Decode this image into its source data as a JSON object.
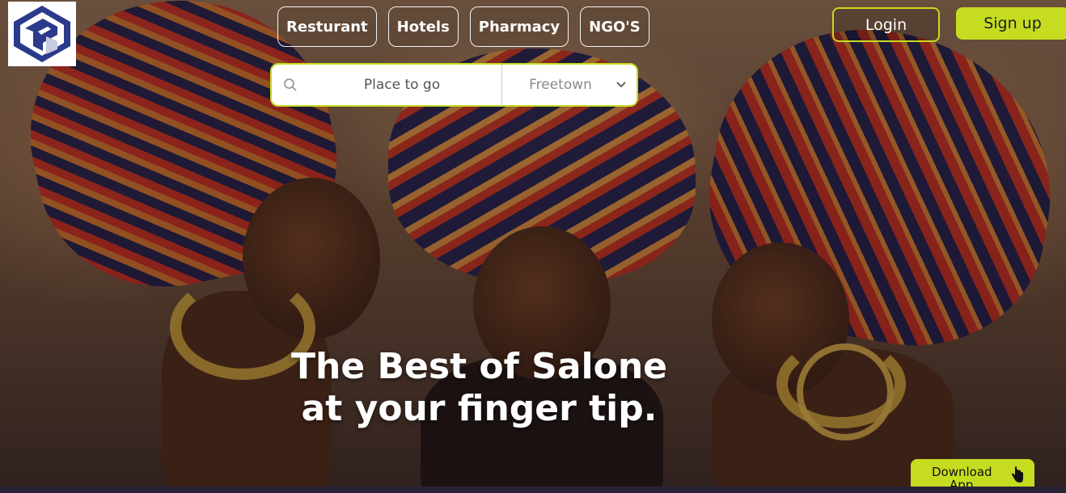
{
  "brand": {
    "logo_icon": "swirl-logo-icon"
  },
  "nav": {
    "items": [
      {
        "label": "Resturant"
      },
      {
        "label": "Hotels"
      },
      {
        "label": "Pharmacy"
      },
      {
        "label": "NGO'S"
      }
    ]
  },
  "auth": {
    "login_label": "Login",
    "signup_label": "Sign up"
  },
  "search": {
    "placeholder": "Place to go",
    "icon": "search-icon",
    "city_selected": "Freetown",
    "city_icon": "chevron-down-icon"
  },
  "hero": {
    "headline_line1": "The Best of Salone",
    "headline_line2": "at your finger tip."
  },
  "download": {
    "label_line1": "Download",
    "label_line2": "App",
    "icon": "tap-hand-icon"
  },
  "colors": {
    "accent": "#c6dc21",
    "text_light": "#ffffff",
    "logo_blue": "#2c3a8c"
  }
}
